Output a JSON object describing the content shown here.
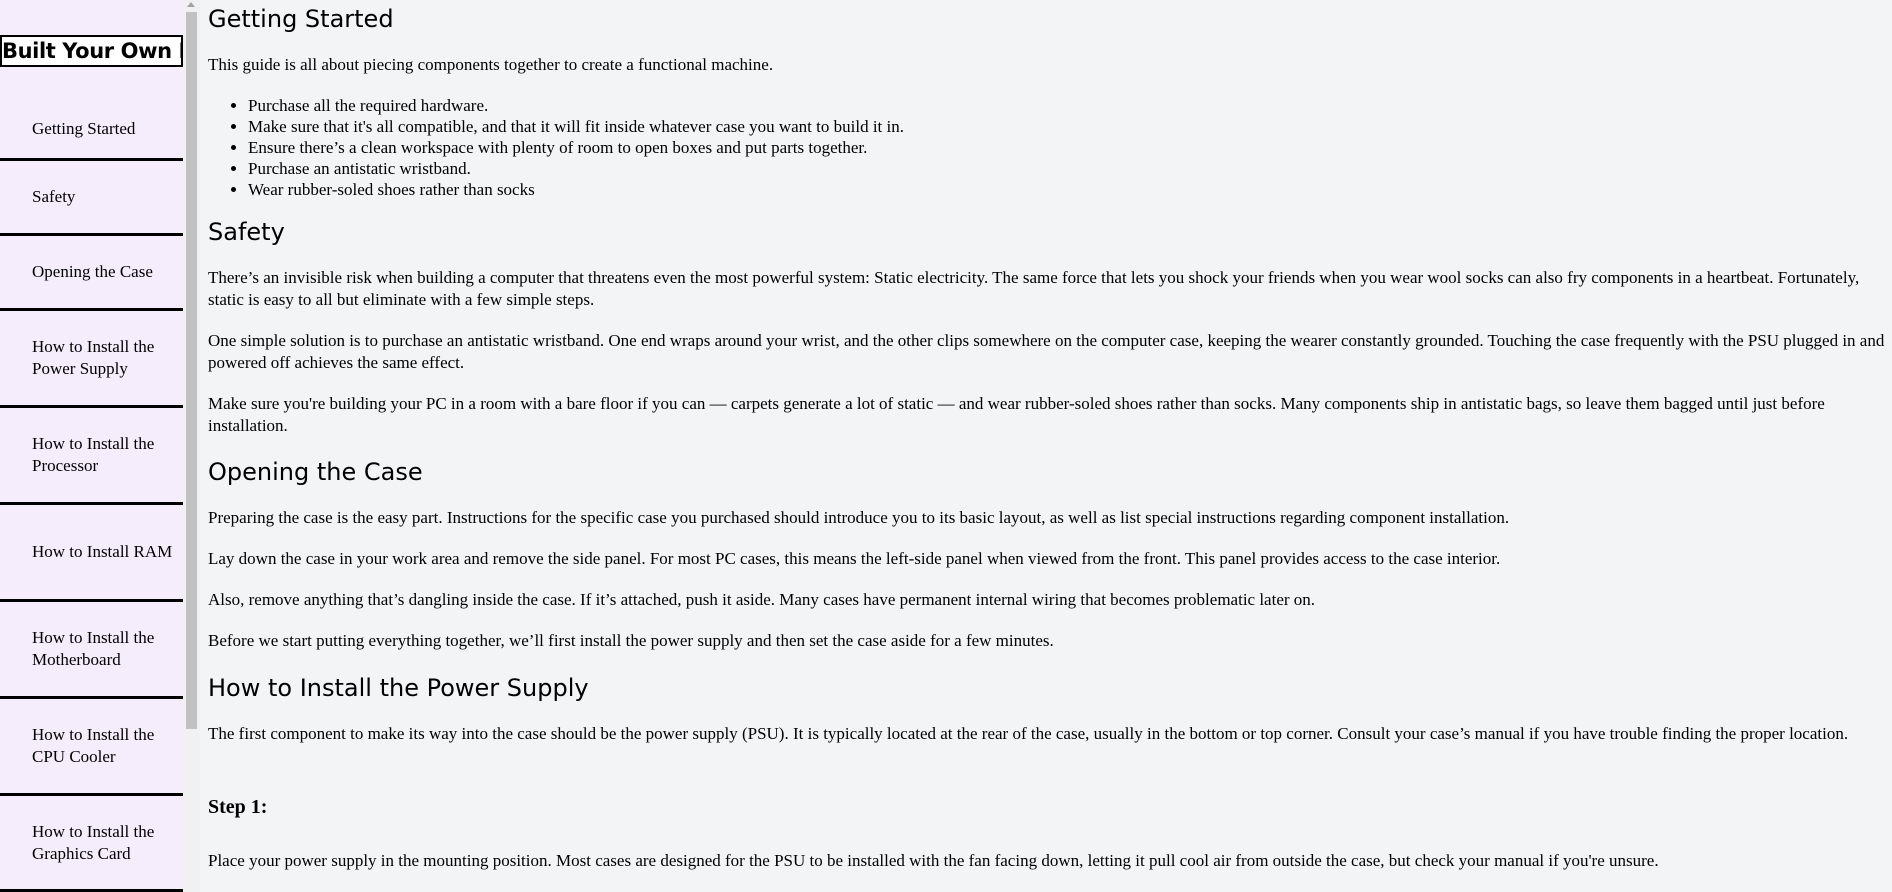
{
  "nav": {
    "title": "Built Your Own Pc",
    "items": [
      {
        "label": "Getting Started"
      },
      {
        "label": "Safety"
      },
      {
        "label": "Opening the Case"
      },
      {
        "label": "How to Install the Power Supply"
      },
      {
        "label": "How to Install the Processor"
      },
      {
        "label": "How to Install RAM"
      },
      {
        "label": "How to Install the Motherboard"
      },
      {
        "label": "How to Install the CPU Cooler"
      },
      {
        "label": "How to Install the Graphics Card"
      }
    ]
  },
  "sections": {
    "getting_started": {
      "heading": "Getting Started",
      "intro": "This guide is all about piecing components together to create a functional machine.",
      "list": [
        "Purchase all the required hardware.",
        "Make sure that it's all compatible, and that it will fit inside whatever case you want to build it in.",
        "Ensure there’s a clean workspace with plenty of room to open boxes and put parts together.",
        "Purchase an antistatic wristband.",
        "Wear rubber-soled shoes rather than socks"
      ]
    },
    "safety": {
      "heading": "Safety",
      "p1": "There’s an invisible risk when building a computer that threatens even the most powerful system: Static electricity. The same force that lets you shock your friends when you wear wool socks can also fry components in a heartbeat. Fortunately, static is easy to all but eliminate with a few simple steps.",
      "p2": "One simple solution is to purchase an antistatic wristband. One end wraps around your wrist, and the other clips somewhere on the computer case, keeping the wearer constantly grounded. Touching the case frequently with the PSU plugged in and powered off achieves the same effect.",
      "p3": "Make sure you're building your PC in a room with a bare floor if you can — carpets generate a lot of static — and wear rubber-soled shoes rather than socks. Many components ship in antistatic bags, so leave them bagged until just before installation."
    },
    "opening_case": {
      "heading": "Opening the Case",
      "p1": "Preparing the case is the easy part. Instructions for the specific case you purchased should introduce you to its basic layout, as well as list special instructions regarding component installation.",
      "p2": "Lay down the case in your work area and remove the side panel. For most PC cases, this means the left-side panel when viewed from the front. This panel provides access to the case interior.",
      "p3": "Also, remove anything that’s dangling inside the case. If it’s attached, push it aside. Many cases have permanent internal wiring that becomes problematic later on.",
      "p4": "Before we start putting everything together, we’ll first install the power supply and then set the case aside for a few minutes."
    },
    "power_supply": {
      "heading": "How to Install the Power Supply",
      "p1": "The first component to make its way into the case should be the power supply (PSU). It is typically located at the rear of the case, usually in the bottom or top corner. Consult your case’s manual if you have trouble finding the proper location.",
      "step1_heading": "Step 1:",
      "step1_text": "Place your power supply in the mounting position. Most cases are designed for the PSU to be installed with the fan facing down, letting it pull cool air from outside the case, but check your manual if you're unsure."
    }
  }
}
